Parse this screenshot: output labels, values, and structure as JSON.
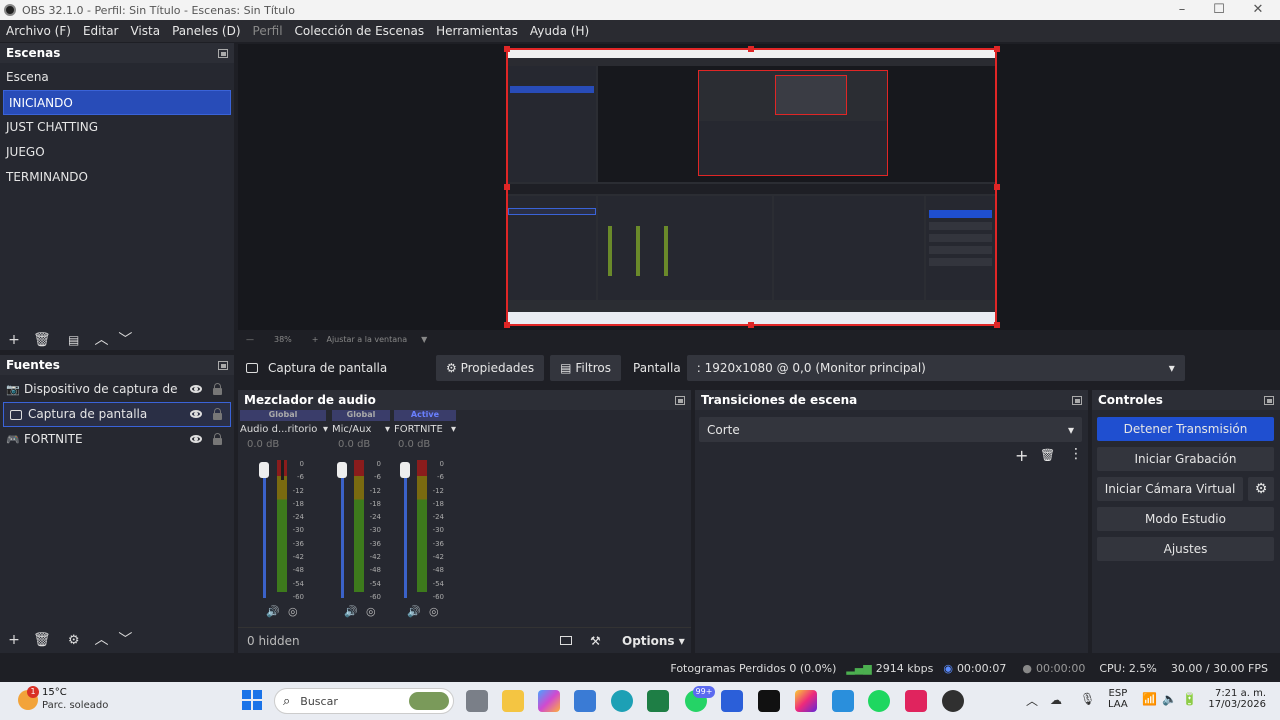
{
  "window": {
    "title": "OBS 32.1.0 - Perfil: Sin Título - Escenas: Sin Título",
    "minimize": "–",
    "maximize": "☐",
    "close": "✕"
  },
  "menu": [
    "Archivo (F)",
    "Editar",
    "Vista",
    "Paneles (D)",
    "Perfil",
    "Colección de Escenas",
    "Herramientas",
    "Ayuda (H)"
  ],
  "scenes": {
    "title": "Escenas",
    "items": [
      "Escena",
      "INICIANDO",
      "JUST CHATTING",
      "JUEGO",
      "TERMINANDO"
    ],
    "selected_index": 1
  },
  "preview": {
    "zoom": "38%",
    "fit_label": "Ajustar a la ventana"
  },
  "source_toolbar": {
    "selected_source": "Captura de pantalla",
    "properties": "Propiedades",
    "filters": "Filtros",
    "display_label": "Pantalla",
    "display_value": ": 1920x1080 @ 0,0 (Monitor principal)"
  },
  "sources": {
    "title": "Fuentes",
    "items": [
      "Dispositivo de captura de video",
      "Captura de pantalla",
      "FORTNITE"
    ],
    "selected_index": 1
  },
  "mixer": {
    "title": "Mezclador de audio",
    "channels": [
      {
        "tag": "Global",
        "name": "Audio d...ritorio",
        "db": "0.0 dB"
      },
      {
        "tag": "Global",
        "name": "Mic/Aux",
        "db": "0.0 dB"
      },
      {
        "tag": "Active",
        "name": "FORTNITE",
        "db": "0.0 dB"
      }
    ],
    "scale": [
      "0",
      "-6",
      "-12",
      "-18",
      "-24",
      "-30",
      "-36",
      "-42",
      "-48",
      "-54",
      "-60"
    ],
    "hidden": "0 hidden",
    "options": "Options"
  },
  "transitions": {
    "title": "Transiciones de escena",
    "selected": "Corte"
  },
  "controls": {
    "title": "Controles",
    "stop_stream": "Detener Transmisión",
    "start_record": "Iniciar Grabación",
    "virtual_cam": "Iniciar Cámara Virtual",
    "studio_mode": "Modo Estudio",
    "settings": "Ajustes"
  },
  "status": {
    "dropped": "Fotogramas Perdidos 0 (0.0%)",
    "bitrate": "2914 kbps",
    "stream_time": "00:00:07",
    "rec_time": "00:00:00",
    "cpu": "CPU: 2.5%",
    "fps": "30.00 / 30.00 FPS"
  },
  "taskbar": {
    "weather_temp": "15°C",
    "weather_desc": "Parc. soleado",
    "weather_badge": "1",
    "search_placeholder": "Buscar",
    "badge_99": "99+",
    "lang1": "ESP",
    "lang2": "LAA",
    "time": "7:21 a. m.",
    "date": "17/03/2026"
  },
  "colors": {
    "accent": "#284cb8",
    "stream_button": "#1f4fd0",
    "preview_border": "#e02626"
  }
}
